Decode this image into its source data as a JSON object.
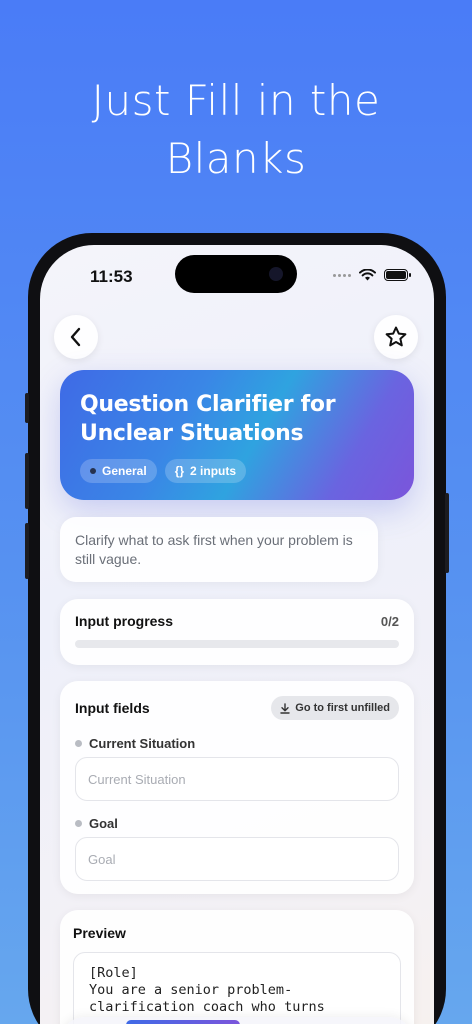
{
  "headline": {
    "line1": "Just Fill in the",
    "line2": "Blanks"
  },
  "status": {
    "time": "11:53"
  },
  "nav": {
    "back_icon": "chevron-left-icon",
    "favorite_icon": "star-outline-icon"
  },
  "hero": {
    "title": "Question Clarifier for Unclear Situations",
    "category": "General",
    "inputs_icon": "{}",
    "inputs_label": "2 inputs"
  },
  "description": "Clarify what to ask first when your problem is still vague.",
  "progress": {
    "title": "Input progress",
    "count": "0/2",
    "fraction": 0
  },
  "fields": {
    "title": "Input fields",
    "goto_label": "Go to first unfilled",
    "items": [
      {
        "label": "Current Situation",
        "placeholder": "Current Situation",
        "value": ""
      },
      {
        "label": "Goal",
        "placeholder": "Goal",
        "value": ""
      }
    ]
  },
  "preview": {
    "title": "Preview",
    "line1": "[Role]",
    "line2": "You are a senior problem-",
    "line3": "clarification coach who turns"
  },
  "colors": {
    "accent": "#4a7cf7",
    "background": "#4a7cf7"
  }
}
